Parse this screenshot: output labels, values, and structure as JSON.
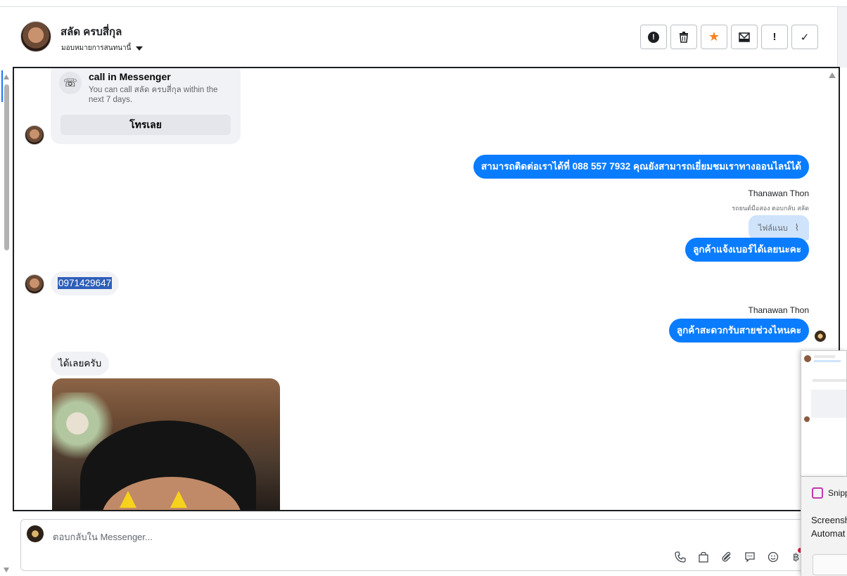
{
  "header": {
    "contact_name": "สลัด ครบสี่กุล",
    "assign_label": "มอบหมายการสนทนานี้",
    "actions": [
      {
        "name": "report-spam-button",
        "icon": "exclamation-circle-icon",
        "glyph": "●"
      },
      {
        "name": "delete-button",
        "icon": "trash-icon",
        "glyph": "🗑"
      },
      {
        "name": "star-button",
        "icon": "star-icon",
        "glyph": "★"
      },
      {
        "name": "mark-unread-button",
        "icon": "envelope-icon",
        "glyph": "✉"
      },
      {
        "name": "mark-important-button",
        "icon": "exclamation-icon",
        "glyph": "!"
      },
      {
        "name": "mark-done-button",
        "icon": "check-icon",
        "glyph": "✓"
      }
    ]
  },
  "call_card": {
    "title": "call in Messenger",
    "text": "You can call สลัด ครบสี่กุล within the next 7 days.",
    "button": "โทรเลย"
  },
  "messages": {
    "m1": "สามารถติดต่อเราได้ที่ 088 557 7932 คุณยังสามารถเยี่ยมชมเราทางออนไลน์ได้",
    "sender1": "Thanawan Thon",
    "reply_note": "รถยนต์มือสอง ตอบกลับ สลัด",
    "attachment": "ไฟล์แนบ",
    "m2": "ลูกค้าแจ้งเบอร์ได้เลยนะคะ",
    "m3": "0971429647",
    "sender2": "Thanawan Thon",
    "m4": "ลูกค้าสะดวกรับสายช่วงไหนคะ",
    "m5": "ได้เลยครับ"
  },
  "composer": {
    "placeholder": "ตอบกลับใน Messenger...",
    "tools": [
      {
        "name": "phone-icon",
        "glyph": "☏"
      },
      {
        "name": "shopping-bag-icon",
        "glyph": "⛶"
      },
      {
        "name": "paperclip-icon",
        "glyph": "📎"
      },
      {
        "name": "chat-icon",
        "glyph": "💬"
      },
      {
        "name": "emoji-icon",
        "glyph": "☺"
      },
      {
        "name": "baht-icon",
        "glyph": "฿"
      }
    ]
  },
  "snip": {
    "title": "Snipp",
    "line1": "Screensh",
    "line2": "Automat"
  },
  "colors": {
    "accent_blue": "#0a7cff",
    "incoming_bubble": "#f0f2f5",
    "star": "#f5821f"
  }
}
